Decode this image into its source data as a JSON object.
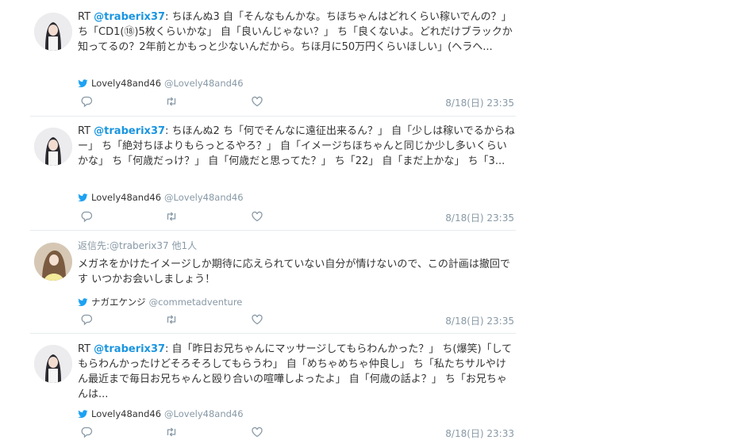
{
  "colors": {
    "link": "#1b95e0",
    "muted": "#8899a6",
    "bird": "#1da1f2",
    "divider": "#e6ecf0"
  },
  "tweets": [
    {
      "prefix": "RT",
      "handle": "@traberix37",
      "body": ": ちほんぬ3 自「そんなもんかな。ちほちゃんはどれくらい稼いでんの？」 ち「CD1(⑱)5枚くらいかな」 自「良いんじゃない？」 ち「良くないよ。どれだけブラックか知ってるの？2年前とかもっと少ないんだから。ちほ月に50万円くらいほしい」(ヘラヘ...",
      "source_name": "Lovely48and46",
      "source_handle": "@Lovely48and46",
      "time": "8/18(日) 23:35",
      "icons": [
        "reply-icon",
        "retweet-icon",
        "like-icon",
        "twitter-bird-icon"
      ]
    },
    {
      "prefix": "RT",
      "handle": "@traberix37",
      "body": ": ちほんぬ2 ち「何でそんなに遠征出来るん？」 自「少しは稼いでるからねー」 ち「絶対ちほよりもらっとるやろ？」 自「イメージちほちゃんと同じか少し多いくらいかな」 ち「何歳だっけ？」 自「何歳だと思ってた？」 ち「22」 自「まだ上かな」 ち「3...",
      "source_name": "Lovely48and46",
      "source_handle": "@Lovely48and46",
      "time": "8/18(日) 23:35"
    },
    {
      "reply_to": "返信先:@traberix37 他1人",
      "body": "メガネをかけたイメージしか期待に応えられていない自分が情けないので、この計画は撤回です いつかお会いしましょう！",
      "source_name": "ナガエケンジ",
      "source_handle": "@commetadventure",
      "time": "8/18(日) 23:35"
    },
    {
      "prefix": "RT",
      "handle": "@traberix37",
      "body": ": 自「昨日お兄ちゃんにマッサージしてもらわんかった？」 ち(爆笑)「してもらわんかったけどそろそろしてもらうわ」 自「めちゃめちゃ仲良し」 ち「私たちサルやけん最近まで毎日お兄ちゃんと殴り合いの喧嘩しよったよ」 自「何歳の話よ？」 ち「お兄ちゃんは...",
      "source_name": "Lovely48and46",
      "source_handle": "@Lovely48and46",
      "time": "8/18(日) 23:33"
    }
  ]
}
